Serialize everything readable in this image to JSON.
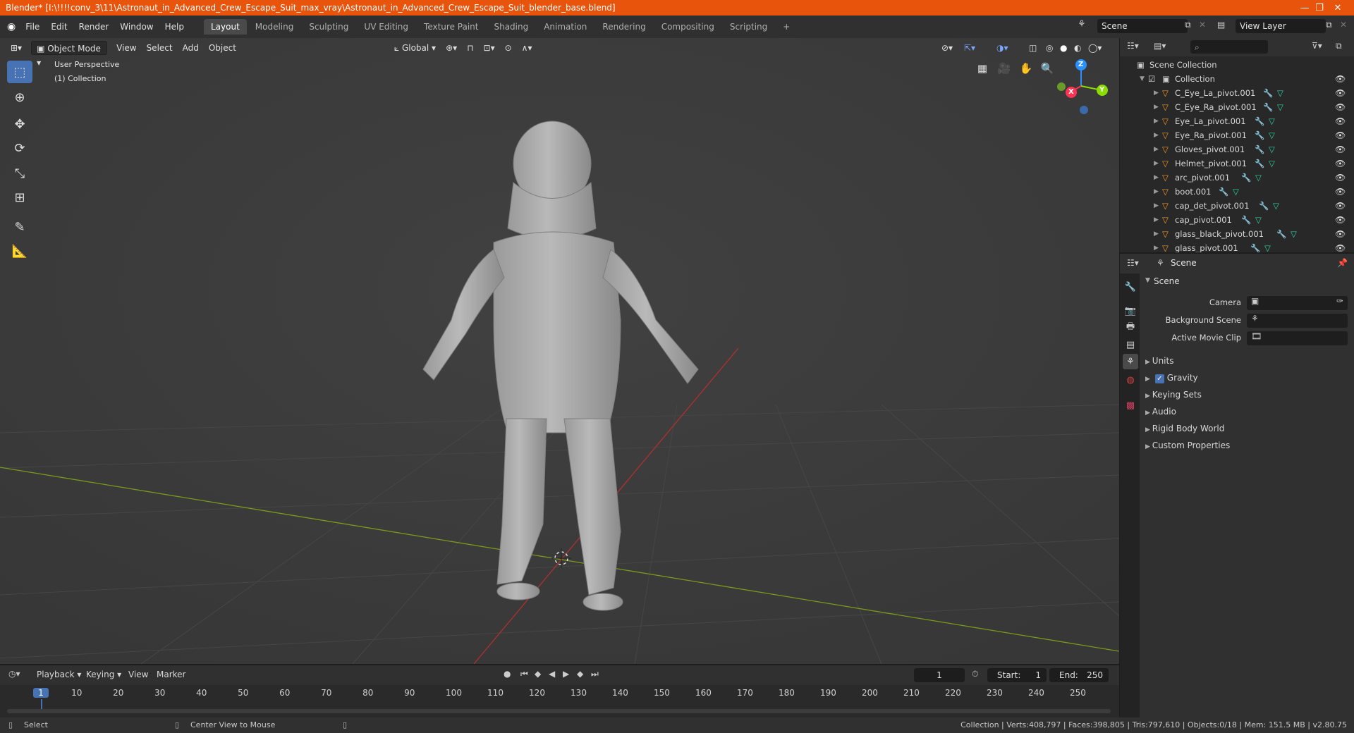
{
  "window": {
    "title": "Blender* [I:\\!!!!conv_3\\11\\Astronaut_in_Advanced_Crew_Escape_Suit_max_vray\\Astronaut_in_Advanced_Crew_Escape_Suit_blender_base.blend]",
    "minimize": "—",
    "maximize": "❐",
    "close": "✕"
  },
  "menu": {
    "items": [
      "File",
      "Edit",
      "Render",
      "Window",
      "Help"
    ],
    "workspaces": [
      "Layout",
      "Modeling",
      "Sculpting",
      "UV Editing",
      "Texture Paint",
      "Shading",
      "Animation",
      "Rendering",
      "Compositing",
      "Scripting"
    ],
    "active_workspace": "Layout",
    "add_tab": "+",
    "scene_name": "Scene",
    "view_layer": "View Layer"
  },
  "viewport": {
    "mode": "Object Mode",
    "menus": [
      "View",
      "Select",
      "Add",
      "Object"
    ],
    "orientation": "Global",
    "overlay_text_1": "User Perspective",
    "overlay_text_2": "(1) Collection",
    "gizmo": {
      "z": "Z",
      "x": "X",
      "y": "Y"
    }
  },
  "outliner": {
    "search_placeholder": "",
    "scene_collection": "Scene Collection",
    "collection": "Collection",
    "objects": [
      "C_Eye_La_pivot.001",
      "C_Eye_Ra_pivot.001",
      "Eye_La_pivot.001",
      "Eye_Ra_pivot.001",
      "Gloves_pivot.001",
      "Helmet_pivot.001",
      "arc_pivot.001",
      "boot.001",
      "cap_det_pivot.001",
      "cap_pivot.001",
      "glass_black_pivot.001",
      "glass_pivot.001"
    ]
  },
  "properties": {
    "context": "Scene",
    "panel": "Scene",
    "camera_label": "Camera",
    "background_scene_label": "Background Scene",
    "active_movie_clip_label": "Active Movie Clip",
    "sections": [
      "Units",
      "Gravity",
      "Keying Sets",
      "Audio",
      "Rigid Body World",
      "Custom Properties"
    ],
    "gravity_checked": true
  },
  "timeline": {
    "menus": [
      "Playback",
      "Keying",
      "View",
      "Marker"
    ],
    "current_frame": "1",
    "start_label": "Start:",
    "start_value": "1",
    "end_label": "End:",
    "end_value": "250",
    "ticks": [
      "1",
      "10",
      "20",
      "30",
      "40",
      "50",
      "60",
      "70",
      "80",
      "90",
      "100",
      "110",
      "120",
      "130",
      "140",
      "150",
      "160",
      "170",
      "180",
      "190",
      "200",
      "210",
      "220",
      "230",
      "240",
      "250"
    ]
  },
  "status": {
    "select": "Select",
    "center_view": "Center View to Mouse",
    "stats": "Collection | Verts:408,797 | Faces:398,805 | Tris:797,610 | Objects:0/18 | Mem: 151.5 MB | v2.80.75"
  },
  "colors": {
    "title_bar": "#e8540c",
    "accent": "#4772b3",
    "axis_x": "#ff3352",
    "axis_y": "#8bdc00",
    "axis_z": "#2890ff"
  }
}
